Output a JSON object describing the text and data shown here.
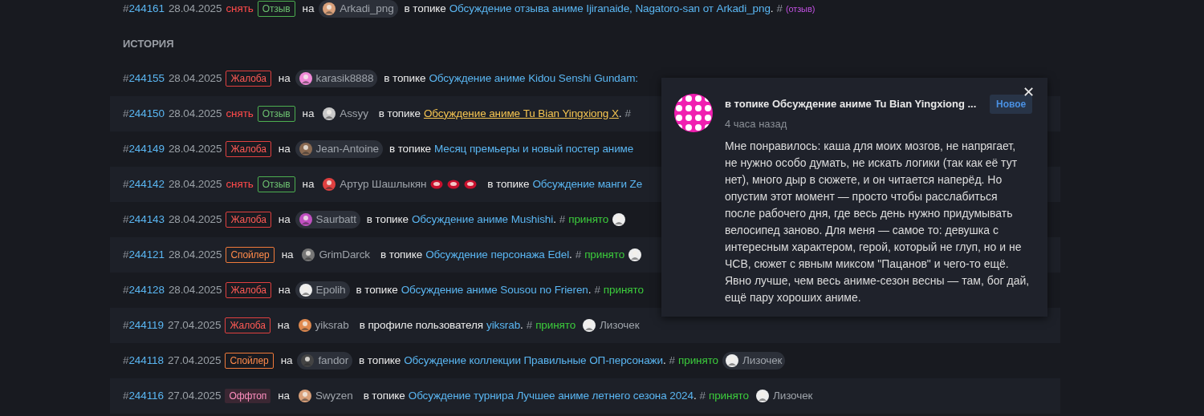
{
  "top_row": {
    "hash": "#",
    "number": "244161",
    "date": "28.04.2025",
    "action": "снять",
    "tag": {
      "kind": "review",
      "label": "Отзыв"
    },
    "on": "на",
    "user": {
      "name": "Arkadi_png",
      "highlighted": true
    },
    "place": "в топике",
    "link": {
      "text": "Обсуждение отзыва аниме Ijiranaide, Nagatoro-san от Arkadi_png",
      "highlighted": false
    },
    "end": ".",
    "status_hash": "#",
    "note": "(отзыв)"
  },
  "section_title": "ИСТОРИЯ",
  "rows": [
    {
      "hash": "#",
      "number": "244155",
      "date": "28.04.2025",
      "tag": {
        "kind": "complaint",
        "label": "Жалоба"
      },
      "on": "на",
      "user": {
        "name": "karasik8888",
        "highlighted": true
      },
      "place": "в топике",
      "link": {
        "text": "Обсуждение аниме Kidou Senshi Gundam:",
        "highlighted": false
      }
    },
    {
      "hash": "#",
      "number": "244150",
      "date": "28.04.2025",
      "action": "снять",
      "tag": {
        "kind": "review",
        "label": "Отзыв"
      },
      "on": "на",
      "user": {
        "name": "Assyy",
        "highlighted": false
      },
      "place": "в топике",
      "link": {
        "text": "Обсуждение аниме Tu Bian Yingxiong X",
        "highlighted": true
      },
      "end": ".",
      "status_hash": "#"
    },
    {
      "hash": "#",
      "number": "244149",
      "date": "28.04.2025",
      "tag": {
        "kind": "complaint",
        "label": "Жалоба"
      },
      "on": "на",
      "user": {
        "name": "Jean-Antoine",
        "highlighted": true
      },
      "place": "в топике",
      "link": {
        "text": "Месяц премьеры и новый постер аниме",
        "highlighted": false
      }
    },
    {
      "hash": "#",
      "number": "244142",
      "date": "28.04.2025",
      "action": "снять",
      "tag": {
        "kind": "review",
        "label": "Отзыв"
      },
      "on": "на",
      "user": {
        "name": "Артур Шашлыкян",
        "highlighted": false,
        "icons": [
          {
            "kind": "meat"
          },
          {
            "kind": "meat"
          },
          {
            "kind": "meat"
          }
        ]
      },
      "place": "в топике",
      "link": {
        "text": "Обсуждение манги Ze",
        "highlighted": false
      }
    },
    {
      "hash": "#",
      "number": "244143",
      "date": "28.04.2025",
      "tag": {
        "kind": "complaint",
        "label": "Жалоба"
      },
      "on": "на",
      "user": {
        "name": "Saurbatt",
        "highlighted": true
      },
      "place": "в топике",
      "link": {
        "text": "Обсуждение аниме Mushishi",
        "highlighted": false
      },
      "end": ".",
      "status_hash": "#",
      "status": "принято",
      "moderator": {}
    },
    {
      "hash": "#",
      "number": "244121",
      "date": "28.04.2025",
      "tag": {
        "kind": "spoiler",
        "label": "Спойлер"
      },
      "on": "на",
      "user": {
        "name": "GrimDarck",
        "highlighted": false
      },
      "place": "в топике",
      "link": {
        "text": "Обсуждение персонажа Edel",
        "highlighted": false
      },
      "end": ".",
      "status_hash": "#",
      "status": "принято",
      "moderator": {}
    },
    {
      "hash": "#",
      "number": "244128",
      "date": "28.04.2025",
      "tag": {
        "kind": "complaint",
        "label": "Жалоба"
      },
      "on": "на",
      "user": {
        "name": "Epolih",
        "highlighted": true
      },
      "place": "в топике",
      "link": {
        "text": "Обсуждение аниме Sousou no Frieren",
        "highlighted": false
      },
      "end": ".",
      "status_hash": "#",
      "status": "принято"
    },
    {
      "hash": "#",
      "number": "244119",
      "date": "27.04.2025",
      "tag": {
        "kind": "complaint",
        "label": "Жалоба"
      },
      "on": "на",
      "user": {
        "name": "yiksrab",
        "highlighted": false
      },
      "place": "в профиле пользователя",
      "link": {
        "text": "yiksrab",
        "highlighted": false
      },
      "end": ".",
      "status_hash": "#",
      "status": "принято",
      "moderator": {
        "name": "Лизочек",
        "highlighted": false
      }
    },
    {
      "hash": "#",
      "number": "244118",
      "date": "27.04.2025",
      "tag": {
        "kind": "spoiler",
        "label": "Спойлер"
      },
      "on": "на",
      "user": {
        "name": "fandor",
        "highlighted": true
      },
      "place": "в топике",
      "link": {
        "text": "Обсуждение коллекции Правильные ОП-персонажи",
        "highlighted": false
      },
      "end": ".",
      "status_hash": "#",
      "status": "принято",
      "moderator": {
        "name": "Лизочек",
        "highlighted": true
      }
    },
    {
      "hash": "#",
      "number": "244116",
      "date": "27.04.2025",
      "tag": {
        "kind": "offtopic",
        "label": "Оффтоп"
      },
      "on": "на",
      "user": {
        "name": "Swyzen",
        "highlighted": false
      },
      "place": "в топике",
      "link": {
        "text": "Обсуждение турнира Лучшее аниме летнего сезона 2024",
        "highlighted": false
      },
      "end": ".",
      "status_hash": "#",
      "status": "принято",
      "moderator": {
        "name": "Лизочек",
        "highlighted": false
      }
    }
  ],
  "popup": {
    "title": "в топике Обсуждение аниме Tu Bian Yingxiong ...",
    "badge": "Новое",
    "close": "✕",
    "time": "4 часа назад",
    "body": "Мне понравилось: каша для моих мозгов, не напрягает, не нужно особо думать, не искать логики (так как её тут нет), много дыр в сюжете, и он читается наперёд. Но опустим этот момент — просто чтобы расслабиться после рабочего дня, где весь день нужно придумывать велосипед заново. Для меня — самое то: девушка с интересным характером, герой, который не глуп, но и не ЧСВ, сюжет с явным миксом \"Пацанов\" и чего-то ещё. Явно лучше, чем весь аниме-сезон весны — там, бог дай, ещё пару хороших аниме."
  }
}
